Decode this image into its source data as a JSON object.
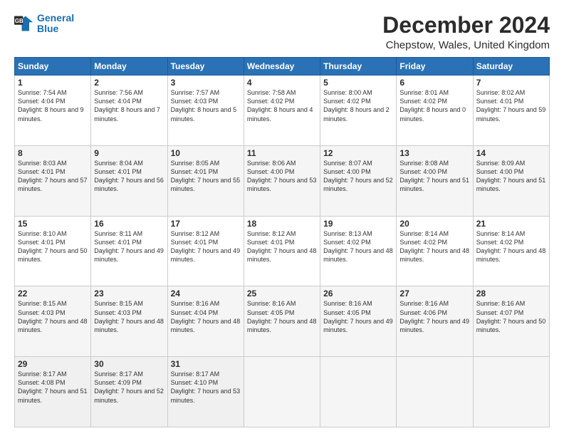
{
  "logo": {
    "line1": "General",
    "line2": "Blue"
  },
  "title": "December 2024",
  "subtitle": "Chepstow, Wales, United Kingdom",
  "days": [
    "Sunday",
    "Monday",
    "Tuesday",
    "Wednesday",
    "Thursday",
    "Friday",
    "Saturday"
  ],
  "weeks": [
    [
      {
        "num": "1",
        "rise": "Sunrise: 7:54 AM",
        "set": "Sunset: 4:04 PM",
        "daylight": "Daylight: 8 hours and 9 minutes."
      },
      {
        "num": "2",
        "rise": "Sunrise: 7:56 AM",
        "set": "Sunset: 4:04 PM",
        "daylight": "Daylight: 8 hours and 7 minutes."
      },
      {
        "num": "3",
        "rise": "Sunrise: 7:57 AM",
        "set": "Sunset: 4:03 PM",
        "daylight": "Daylight: 8 hours and 5 minutes."
      },
      {
        "num": "4",
        "rise": "Sunrise: 7:58 AM",
        "set": "Sunset: 4:02 PM",
        "daylight": "Daylight: 8 hours and 4 minutes."
      },
      {
        "num": "5",
        "rise": "Sunrise: 8:00 AM",
        "set": "Sunset: 4:02 PM",
        "daylight": "Daylight: 8 hours and 2 minutes."
      },
      {
        "num": "6",
        "rise": "Sunrise: 8:01 AM",
        "set": "Sunset: 4:02 PM",
        "daylight": "Daylight: 8 hours and 0 minutes."
      },
      {
        "num": "7",
        "rise": "Sunrise: 8:02 AM",
        "set": "Sunset: 4:01 PM",
        "daylight": "Daylight: 7 hours and 59 minutes."
      }
    ],
    [
      {
        "num": "8",
        "rise": "Sunrise: 8:03 AM",
        "set": "Sunset: 4:01 PM",
        "daylight": "Daylight: 7 hours and 57 minutes."
      },
      {
        "num": "9",
        "rise": "Sunrise: 8:04 AM",
        "set": "Sunset: 4:01 PM",
        "daylight": "Daylight: 7 hours and 56 minutes."
      },
      {
        "num": "10",
        "rise": "Sunrise: 8:05 AM",
        "set": "Sunset: 4:01 PM",
        "daylight": "Daylight: 7 hours and 55 minutes."
      },
      {
        "num": "11",
        "rise": "Sunrise: 8:06 AM",
        "set": "Sunset: 4:00 PM",
        "daylight": "Daylight: 7 hours and 53 minutes."
      },
      {
        "num": "12",
        "rise": "Sunrise: 8:07 AM",
        "set": "Sunset: 4:00 PM",
        "daylight": "Daylight: 7 hours and 52 minutes."
      },
      {
        "num": "13",
        "rise": "Sunrise: 8:08 AM",
        "set": "Sunset: 4:00 PM",
        "daylight": "Daylight: 7 hours and 51 minutes."
      },
      {
        "num": "14",
        "rise": "Sunrise: 8:09 AM",
        "set": "Sunset: 4:00 PM",
        "daylight": "Daylight: 7 hours and 51 minutes."
      }
    ],
    [
      {
        "num": "15",
        "rise": "Sunrise: 8:10 AM",
        "set": "Sunset: 4:01 PM",
        "daylight": "Daylight: 7 hours and 50 minutes."
      },
      {
        "num": "16",
        "rise": "Sunrise: 8:11 AM",
        "set": "Sunset: 4:01 PM",
        "daylight": "Daylight: 7 hours and 49 minutes."
      },
      {
        "num": "17",
        "rise": "Sunrise: 8:12 AM",
        "set": "Sunset: 4:01 PM",
        "daylight": "Daylight: 7 hours and 49 minutes."
      },
      {
        "num": "18",
        "rise": "Sunrise: 8:12 AM",
        "set": "Sunset: 4:01 PM",
        "daylight": "Daylight: 7 hours and 48 minutes."
      },
      {
        "num": "19",
        "rise": "Sunrise: 8:13 AM",
        "set": "Sunset: 4:02 PM",
        "daylight": "Daylight: 7 hours and 48 minutes."
      },
      {
        "num": "20",
        "rise": "Sunrise: 8:14 AM",
        "set": "Sunset: 4:02 PM",
        "daylight": "Daylight: 7 hours and 48 minutes."
      },
      {
        "num": "21",
        "rise": "Sunrise: 8:14 AM",
        "set": "Sunset: 4:02 PM",
        "daylight": "Daylight: 7 hours and 48 minutes."
      }
    ],
    [
      {
        "num": "22",
        "rise": "Sunrise: 8:15 AM",
        "set": "Sunset: 4:03 PM",
        "daylight": "Daylight: 7 hours and 48 minutes."
      },
      {
        "num": "23",
        "rise": "Sunrise: 8:15 AM",
        "set": "Sunset: 4:03 PM",
        "daylight": "Daylight: 7 hours and 48 minutes."
      },
      {
        "num": "24",
        "rise": "Sunrise: 8:16 AM",
        "set": "Sunset: 4:04 PM",
        "daylight": "Daylight: 7 hours and 48 minutes."
      },
      {
        "num": "25",
        "rise": "Sunrise: 8:16 AM",
        "set": "Sunset: 4:05 PM",
        "daylight": "Daylight: 7 hours and 48 minutes."
      },
      {
        "num": "26",
        "rise": "Sunrise: 8:16 AM",
        "set": "Sunset: 4:05 PM",
        "daylight": "Daylight: 7 hours and 49 minutes."
      },
      {
        "num": "27",
        "rise": "Sunrise: 8:16 AM",
        "set": "Sunset: 4:06 PM",
        "daylight": "Daylight: 7 hours and 49 minutes."
      },
      {
        "num": "28",
        "rise": "Sunrise: 8:16 AM",
        "set": "Sunset: 4:07 PM",
        "daylight": "Daylight: 7 hours and 50 minutes."
      }
    ],
    [
      {
        "num": "29",
        "rise": "Sunrise: 8:17 AM",
        "set": "Sunset: 4:08 PM",
        "daylight": "Daylight: 7 hours and 51 minutes."
      },
      {
        "num": "30",
        "rise": "Sunrise: 8:17 AM",
        "set": "Sunset: 4:09 PM",
        "daylight": "Daylight: 7 hours and 52 minutes."
      },
      {
        "num": "31",
        "rise": "Sunrise: 8:17 AM",
        "set": "Sunset: 4:10 PM",
        "daylight": "Daylight: 7 hours and 53 minutes."
      },
      null,
      null,
      null,
      null
    ]
  ]
}
